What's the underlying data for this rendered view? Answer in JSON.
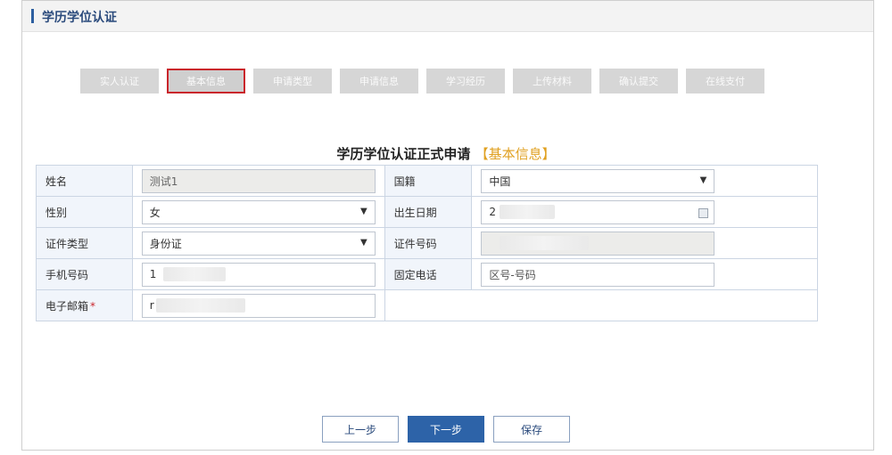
{
  "header": {
    "title": "学历学位认证"
  },
  "steps": [
    {
      "label": "实人认证",
      "active": false
    },
    {
      "label": "基本信息",
      "active": true
    },
    {
      "label": "申请类型",
      "active": false
    },
    {
      "label": "申请信息",
      "active": false
    },
    {
      "label": "学习经历",
      "active": false
    },
    {
      "label": "上传材料",
      "active": false
    },
    {
      "label": "确认提交",
      "active": false
    },
    {
      "label": "在线支付",
      "active": false
    }
  ],
  "form": {
    "title": "学历学位认证正式申请",
    "subtitle": "【基本信息】",
    "fields": {
      "name_label": "姓名",
      "name_value": "测试1",
      "nationality_label": "国籍",
      "nationality_value": "中国",
      "gender_label": "性别",
      "gender_value": "女",
      "birth_label": "出生日期",
      "birth_value": "2",
      "idtype_label": "证件类型",
      "idtype_value": "身份证",
      "idnumber_label": "证件号码",
      "idnumber_value": "",
      "phone_label": "手机号码",
      "phone_value": "1",
      "landline_label": "固定电话",
      "landline_placeholder": "区号-号码",
      "email_label": "电子邮箱",
      "email_required": "*",
      "email_value": "r"
    }
  },
  "actions": {
    "prev": "上一步",
    "next": "下一步",
    "save": "保存"
  }
}
